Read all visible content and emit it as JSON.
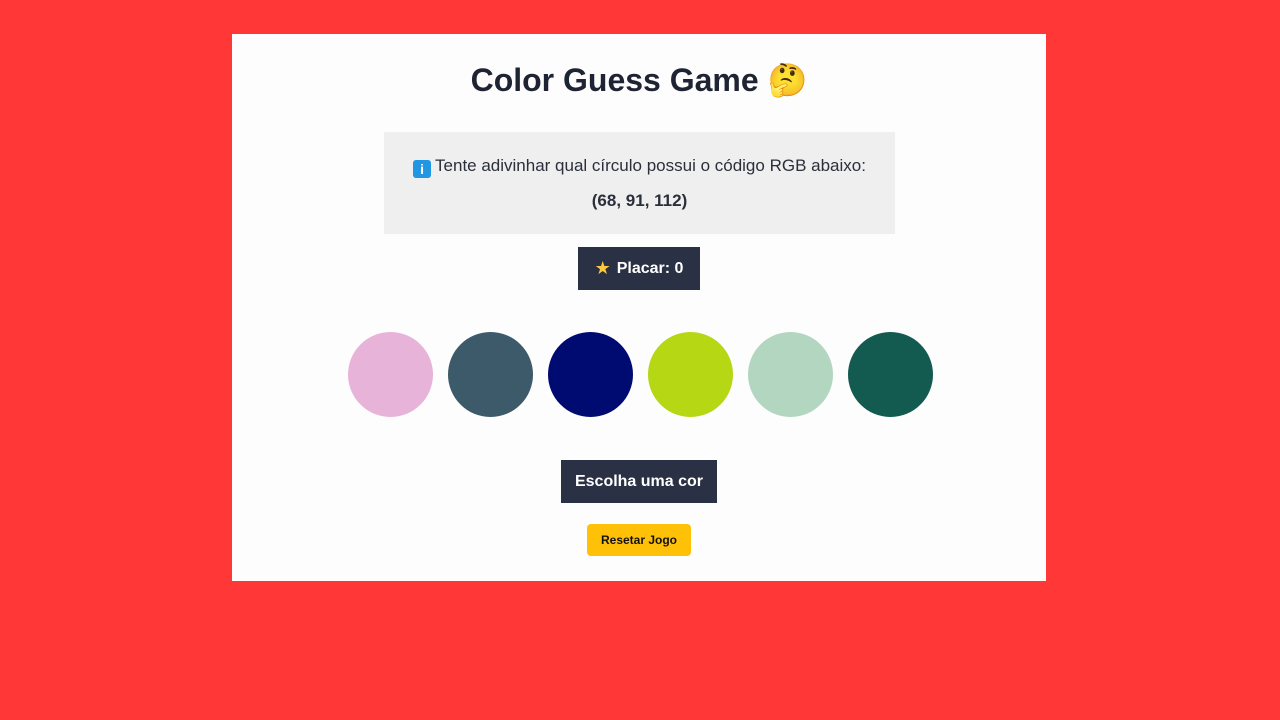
{
  "game": {
    "title": "Color Guess Game 🤔",
    "instruction": "Tente adivinhar qual círculo possui o código RGB abaixo:",
    "info_icon_glyph": "i",
    "rgb_code": "(68, 91, 112)",
    "score_label": "Placar: 0",
    "score_value": 0,
    "star_icon_glyph": "★",
    "status_message": "Escolha uma cor",
    "reset_label": "Resetar Jogo",
    "circles": [
      {
        "color": "#e7b3d8"
      },
      {
        "color": "#3c5a6a"
      },
      {
        "color": "#000b72"
      },
      {
        "color": "#b5d714"
      },
      {
        "color": "#b2d6c0"
      },
      {
        "color": "#135a50"
      }
    ]
  },
  "colors": {
    "background": "#ff3737",
    "card": "#fdfdfd",
    "dark_box": "#2a3144",
    "reset_button": "#ffc107",
    "info_box": "#efefef"
  },
  "icons": {
    "info": "info-icon",
    "star": "star-icon"
  }
}
